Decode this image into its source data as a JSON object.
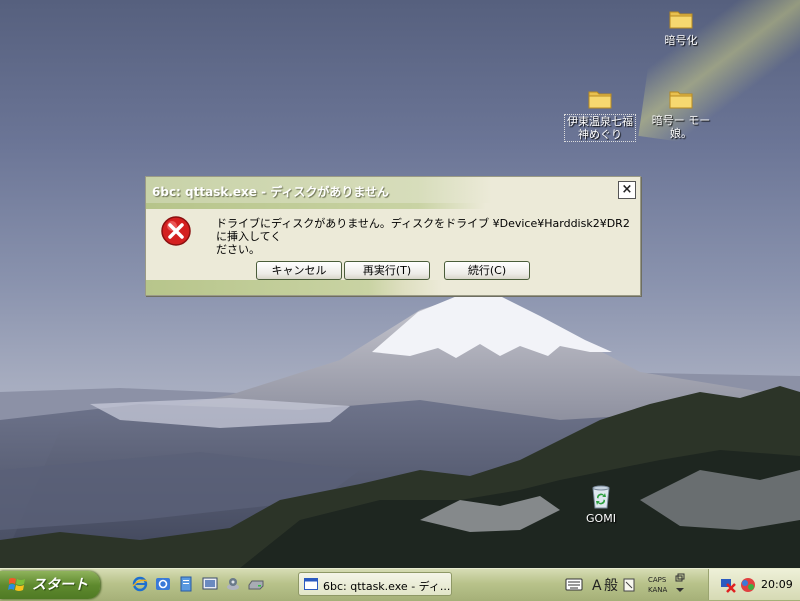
{
  "desktop": {
    "icons": [
      {
        "label": "暗号化",
        "icon": "folder-icon"
      },
      {
        "label": "伊東温泉七福神めぐり",
        "line1": "伊東温泉七福",
        "line2": "神めぐり",
        "icon": "folder-icon"
      },
      {
        "label": "暗号ーモー娘。",
        "line1": "暗号ー モー",
        "line2": "娘。",
        "icon": "folder-icon"
      },
      {
        "label": "GOMI",
        "icon": "recycle-bin-icon"
      }
    ]
  },
  "dialog": {
    "title": "6bc: qttask.exe - ディスクがありません",
    "message": "ドライブにディスクがありません。ディスクをドライブ ¥Device¥Harddisk2¥DR2 に挿入してください。",
    "message_line1": "ドライブにディスクがありません。ディスクをドライブ ¥Device¥Harddisk2¥DR2 に挿入してく",
    "message_line2": "ださい。",
    "close_label": "×",
    "buttons": {
      "cancel": "キャンセル",
      "retry": "再実行(T)",
      "continue": "続行(C)"
    }
  },
  "taskbar": {
    "start_label": "スタート",
    "quick_launch": [
      "ie-icon",
      "mail-icon",
      "document-icon",
      "desktop-icon",
      "media-icon",
      "drive-icon"
    ],
    "task_button": "6bc: qttask.exe - ディ...",
    "ime": {
      "mode": "A",
      "kanji": "般",
      "caps": "CAPS",
      "kana": "KANA"
    },
    "clock": "20:09"
  },
  "colors": {
    "accent_green": "#5f8a2e",
    "dialog_bg": "#ecead8",
    "error_red": "#d42020"
  }
}
